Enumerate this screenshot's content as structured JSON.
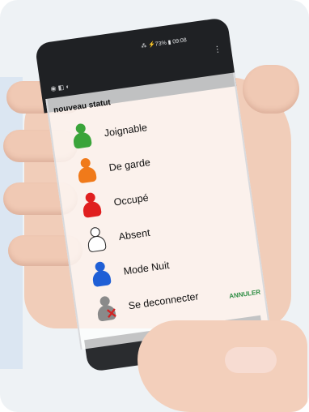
{
  "status_bar": {
    "text": "⁂ ⚡73% ▮ 09:08"
  },
  "dialog": {
    "title": "nouveau statut",
    "cancel_label": "ANNULER",
    "options": [
      {
        "label": "Joignable",
        "color": "#3aa43a",
        "icon": "person-icon-green"
      },
      {
        "label": "De garde",
        "color": "#f07a1a",
        "icon": "person-icon-orange"
      },
      {
        "label": "Occupé",
        "color": "#e01f1f",
        "icon": "person-icon-red"
      },
      {
        "label": "Absent",
        "color": "#ffffff",
        "icon": "person-icon-outline"
      },
      {
        "label": "Mode Nuit",
        "color": "#1f5fd6",
        "icon": "person-icon-blue"
      },
      {
        "label": "Se deconnecter",
        "color": "#8a8a8a",
        "icon": "person-icon-grey-crossed"
      }
    ]
  }
}
